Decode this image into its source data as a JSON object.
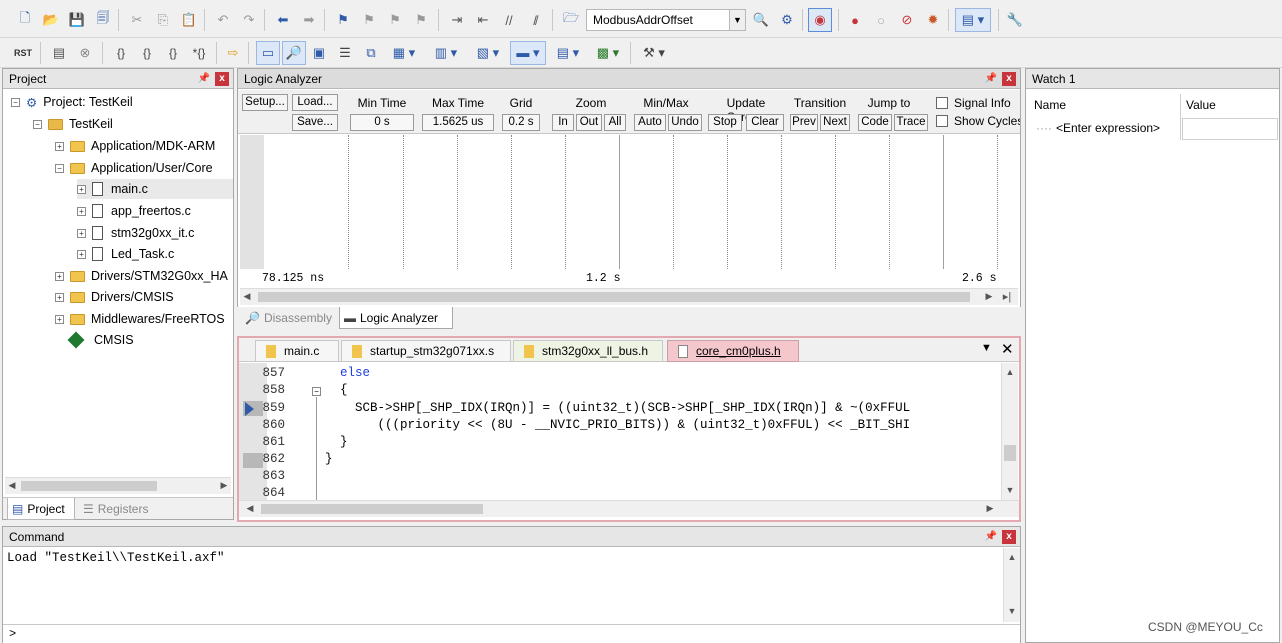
{
  "toolbar1": {
    "target_combo": "ModbusAddrOffset",
    "icons": [
      "new-file-icon",
      "open-icon",
      "save-icon",
      "save-all-icon",
      "cut-icon",
      "copy-icon",
      "paste-icon",
      "undo-icon",
      "redo-icon",
      "nav-back-icon",
      "nav-forward-icon",
      "bookmark-icon",
      "prev-bookmark-icon",
      "next-bookmark-icon",
      "clear-bookmark-icon",
      "indent-icon",
      "unindent-icon",
      "comment-icon",
      "uncomment-icon",
      "find-in-files-icon",
      "find-icon",
      "debug-session-icon",
      "breakpoint-icon",
      "disable-breakpoint-icon",
      "kill-breakpoints-icon",
      "window-layout-icon",
      "configure-icon"
    ]
  },
  "toolbar2": {
    "rst_label": "RST",
    "icons": [
      "reset-icon",
      "run-icon",
      "stop-icon",
      "step-into-icon",
      "step-over-icon",
      "step-out-icon",
      "run-to-cursor-icon",
      "show-next-statement-icon",
      "command-window-icon",
      "disassembly-window-icon",
      "symbols-window-icon",
      "registers-window-icon",
      "call-stack-icon",
      "watch-window-icon",
      "memory-window-icon",
      "serial-window-icon",
      "analysis-window-icon",
      "trace-window-icon",
      "system-viewer-icon",
      "toolbox-icon"
    ]
  },
  "project_panel": {
    "title": "Project",
    "tree": [
      {
        "label": "Project: TestKeil",
        "level": 0,
        "kind": "project"
      },
      {
        "label": "TestKeil",
        "level": 1,
        "kind": "target"
      },
      {
        "label": "Application/MDK-ARM",
        "level": 2,
        "kind": "folder"
      },
      {
        "label": "Application/User/Core",
        "level": 2,
        "kind": "folder"
      },
      {
        "label": "main.c",
        "level": 3,
        "kind": "file"
      },
      {
        "label": "app_freertos.c",
        "level": 3,
        "kind": "file"
      },
      {
        "label": "stm32g0xx_it.c",
        "level": 3,
        "kind": "file"
      },
      {
        "label": "Led_Task.c",
        "level": 3,
        "kind": "file"
      },
      {
        "label": "Drivers/STM32G0xx_HA",
        "level": 2,
        "kind": "folder"
      },
      {
        "label": "Drivers/CMSIS",
        "level": 2,
        "kind": "folder"
      },
      {
        "label": "Middlewares/FreeRTOS",
        "level": 2,
        "kind": "folder"
      },
      {
        "label": "CMSIS",
        "level": 2,
        "kind": "component"
      }
    ],
    "tabs": {
      "project": "Project",
      "registers": "Registers"
    }
  },
  "logic_analyzer": {
    "title": "Logic Analyzer",
    "setup": "Setup...",
    "load": "Load...",
    "save": "Save...",
    "min_time_label": "Min Time",
    "min_time_value": "0 s",
    "max_time_label": "Max Time",
    "max_time_value": "1.5625 us",
    "grid_label": "Grid",
    "grid_value": "0.2 s",
    "zoom_label": "Zoom",
    "zoom_in": "In",
    "zoom_out": "Out",
    "zoom_all": "All",
    "minmax_label": "Min/Max",
    "minmax_auto": "Auto",
    "minmax_undo": "Undo",
    "update_label": "Update Screen",
    "update_stop": "Stop",
    "update_clear": "Clear",
    "transition_label": "Transition",
    "transition_prev": "Prev",
    "transition_next": "Next",
    "jump_label": "Jump to",
    "jump_code": "Code",
    "jump_trace": "Trace",
    "signal_info": "Signal Info",
    "show_cycles": "Show Cycles",
    "time_left": "78.125 ns",
    "time_mid": "1.2 s",
    "time_right": "2.6 s"
  },
  "view_tabs": {
    "disassembly": "Disassembly",
    "logic_analyzer": "Logic Analyzer"
  },
  "editor_tabs": [
    "main.c",
    "startup_stm32g071xx.s",
    "stm32g0xx_ll_bus.h",
    "core_cm0plus.h"
  ],
  "editor": {
    "lines": [
      {
        "n": "857",
        "code": "  else"
      },
      {
        "n": "858",
        "code": "  {"
      },
      {
        "n": "859",
        "code": "    SCB->SHP[_SHP_IDX(IRQn)] = ((uint32_t)(SCB->SHP[_SHP_IDX(IRQn)] & ~(0xFFUL"
      },
      {
        "n": "860",
        "code": "       (((priority << (8U - __NVIC_PRIO_BITS)) & (uint32_t)0xFFUL) << _BIT_SHI"
      },
      {
        "n": "861",
        "code": "  }"
      },
      {
        "n": "862",
        "code": "}"
      },
      {
        "n": "863",
        "code": ""
      },
      {
        "n": "864",
        "code": ""
      }
    ]
  },
  "watch": {
    "title": "Watch 1",
    "col_name": "Name",
    "col_value": "Value",
    "placeholder_row": "<Enter expression>"
  },
  "command": {
    "title": "Command",
    "output": "Load \"TestKeil\\\\TestKeil.axf\"",
    "prompt": ">"
  },
  "watermark": "CSDN @MEYOU_Cc",
  "colors": {
    "accent_blue": "#2e5aa8",
    "close_red": "#c8343c",
    "active_tab": "#f3c7cc",
    "keyword_blue": "#1f3fd8"
  }
}
